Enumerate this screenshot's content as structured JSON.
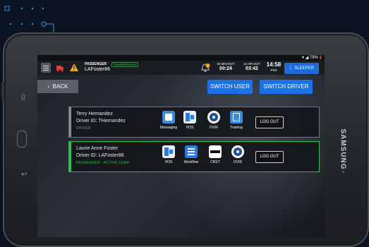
{
  "tablet_brand": "SAMSUNG",
  "status_bar": {
    "battery": "78%"
  },
  "header": {
    "role_label": "PASSENGER",
    "status_pill": "TRANSPORTING",
    "username": "LAFoster86",
    "dot_timer": {
      "label": "30 MIN DOT",
      "value": "00:24"
    },
    "hr_timer": {
      "label": "11 HR DOT",
      "value": "03:42"
    },
    "clock": {
      "time": "14:58",
      "zone": "PSS"
    },
    "sleeper_label": "SLEEPER"
  },
  "nav": {
    "back_label": "BACK",
    "switch_user_label": "SWITCH USER",
    "switch_driver_label": "SWITCH DRIVER"
  },
  "drivers": [
    {
      "name": "Terry Hernandez",
      "driver_id": "Driver ID: THernandez",
      "role": "DRIVER",
      "apps": [
        "Messaging",
        "HOS",
        "DVIR",
        "Training"
      ],
      "logout_label": "LOG OUT"
    },
    {
      "name": "Laurie Anne Foster",
      "driver_id": "Driver ID: LAFoster86",
      "role": "PASSENGER - ACTIVE USER",
      "apps": [
        "HOS",
        "Workflow",
        "CRST",
        "DVIR"
      ],
      "logout_label": "LOG OUT"
    }
  ],
  "colors": {
    "accent_blue": "#1a72e6",
    "active_green": "#2fbf4f",
    "alert_red": "#e23b3b",
    "warning_orange": "#f5a623",
    "background": "#0a1422"
  }
}
